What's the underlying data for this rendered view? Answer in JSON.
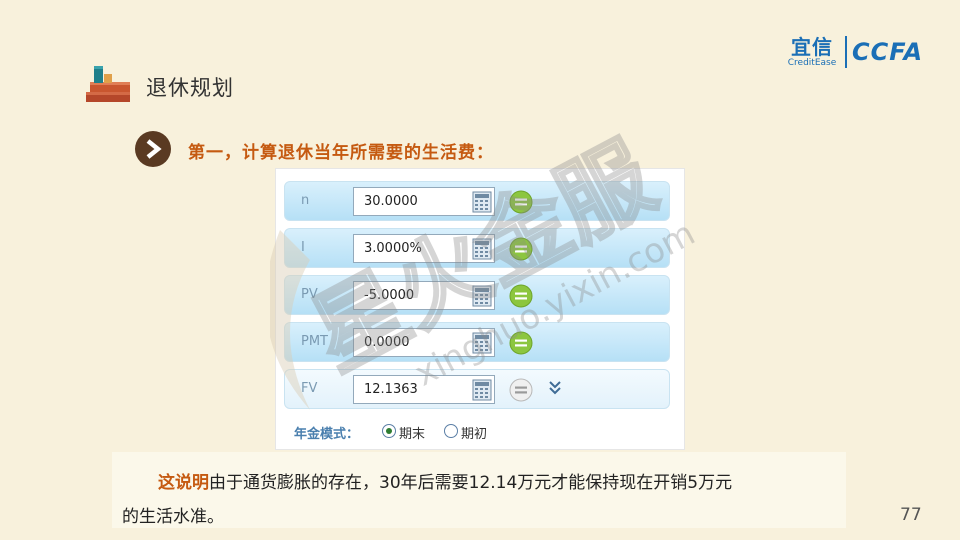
{
  "logo": {
    "brand_cn": "宜信",
    "brand_en": "CreditEase",
    "partner": "CCFA"
  },
  "page": {
    "title": "退休规划",
    "step_heading": "第一，计算退休当年所需要的生活费：",
    "page_number": "77"
  },
  "watermark": {
    "cn": "星火金服",
    "url": "xinghuo.yixin.com"
  },
  "calculator": {
    "rows": [
      {
        "label": "n",
        "value": "30.0000"
      },
      {
        "label": "I",
        "value": "3.0000%"
      },
      {
        "label": "PV",
        "value": "-5.0000"
      },
      {
        "label": "PMT",
        "value": "0.0000"
      },
      {
        "label": "FV",
        "value": "12.1363"
      }
    ],
    "mode_label": "年金模式：",
    "mode_options": [
      "期末",
      "期初"
    ],
    "mode_selected": "期末"
  },
  "note": {
    "highlight": "这说明",
    "line1_rest": "由于通货膨胀的存在，30年后需要12.14万元才能保持现在开销5万元",
    "line2": "的生活水准。"
  },
  "colors": {
    "background": "#f8f1dc",
    "accent_orange": "#c55a11",
    "brand_blue": "#1b6fb6",
    "row_blue": "#b6e0f6",
    "equal_green": "#8cc63f"
  },
  "icons": {
    "title_icon": "books-icon",
    "step_icon": "chevron-right-icon",
    "calc_icon": "calculator-icon",
    "equal_icon": "equals-icon",
    "expand_icon": "double-chevron-down-icon"
  }
}
